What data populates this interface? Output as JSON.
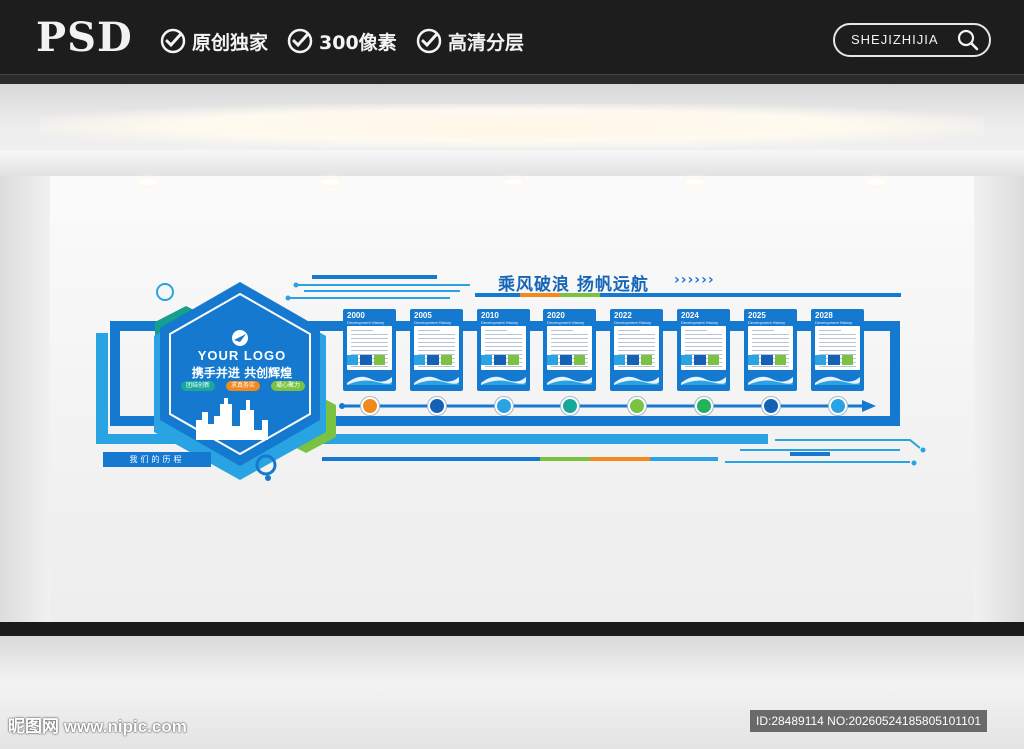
{
  "banner": {
    "brand": "PSD",
    "features": [
      "原创独家",
      "300像素",
      "高清分层"
    ],
    "search_label": "SHEJIZHIJIA"
  },
  "wall": {
    "title": "乘风破浪  扬帆远航",
    "chevrons": "››››››",
    "logo_text": "YOUR LOGO",
    "slogan": "携手并进 共创辉煌",
    "tags": [
      "团结创新",
      "求真务实",
      "凝心聚力"
    ],
    "history_label": "我们的历程",
    "timeline": [
      {
        "year": "2000",
        "subtitle": "Development History"
      },
      {
        "year": "2005",
        "subtitle": "Development History"
      },
      {
        "year": "2010",
        "subtitle": "Development History"
      },
      {
        "year": "2020",
        "subtitle": "Development History"
      },
      {
        "year": "2022",
        "subtitle": "Development History"
      },
      {
        "year": "2024",
        "subtitle": "Development History"
      },
      {
        "year": "2025",
        "subtitle": "Development History"
      },
      {
        "year": "2028",
        "subtitle": "Development History"
      }
    ],
    "node_colors": [
      "#f08a1c",
      "#1461b5",
      "#29a3e2",
      "#17a89a",
      "#7cc242",
      "#22b45a",
      "#1461b5",
      "#29a3e2"
    ]
  },
  "colors": {
    "primary_blue": "#1479cf",
    "dark_blue": "#0e5aa8",
    "green": "#6cbd45",
    "teal": "#159f8e",
    "orange": "#f08a1c"
  },
  "watermark": {
    "site": "昵图网 www.nipic.com",
    "id": "ID:28489114 NO:20260524185805101101"
  }
}
